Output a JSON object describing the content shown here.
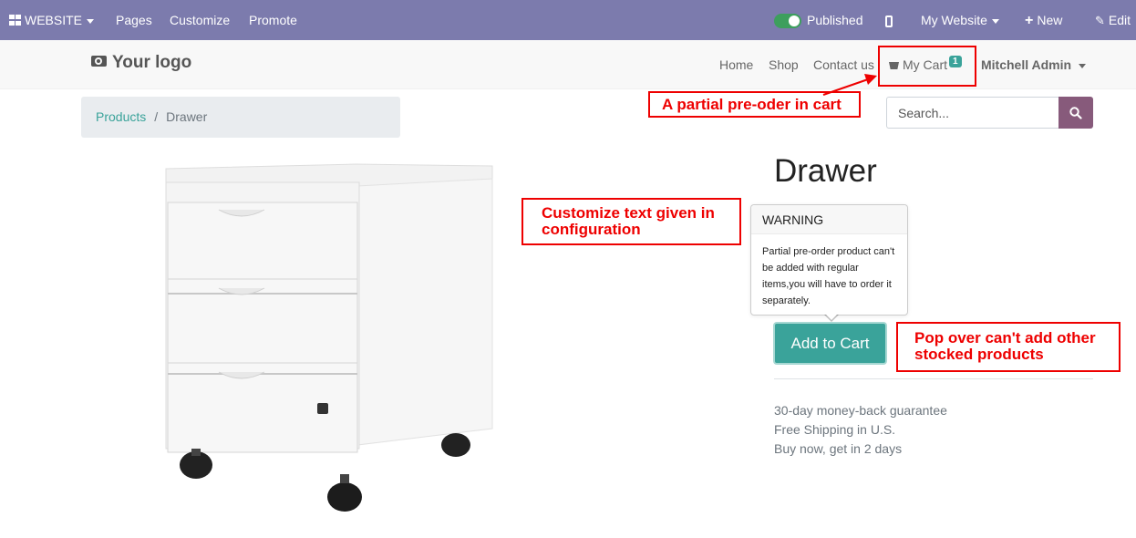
{
  "adminbar": {
    "website_label": "WEBSITE",
    "pages_label": "Pages",
    "customize_label": "Customize",
    "promote_label": "Promote",
    "published_label": "Published",
    "my_website_label": "My Website",
    "new_label": "New",
    "edit_label": "Edit"
  },
  "header": {
    "logo_text": "Your logo",
    "nav": {
      "home": "Home",
      "shop": "Shop",
      "contact": "Contact us",
      "cart": "My Cart",
      "cart_count": "1",
      "user": "Mitchell Admin"
    }
  },
  "breadcrumb": {
    "parent": "Products",
    "separator": "/",
    "current": "Drawer"
  },
  "search": {
    "placeholder": "Search..."
  },
  "product": {
    "name": "Drawer",
    "add_to_cart": "Add to Cart",
    "info": [
      "30-day money-back guarantee",
      "Free Shipping in U.S.",
      "Buy now, get in 2 days"
    ]
  },
  "popover": {
    "title": "WARNING",
    "body": "Partial pre-order product can't be added with regular items,you will have to order it separately."
  },
  "annotations": {
    "cart_note": "A partial pre-oder in cart",
    "config_note_line1": "Customize text given in",
    "config_note_line2": "configuration",
    "popover_note_line1": "Pop over can't add other",
    "popover_note_line2": "stocked products"
  },
  "colors": {
    "adminbar": "#7c7bad",
    "accent": "#3aa39a",
    "search_button": "#875a7b",
    "annotation": "#ee0000"
  }
}
